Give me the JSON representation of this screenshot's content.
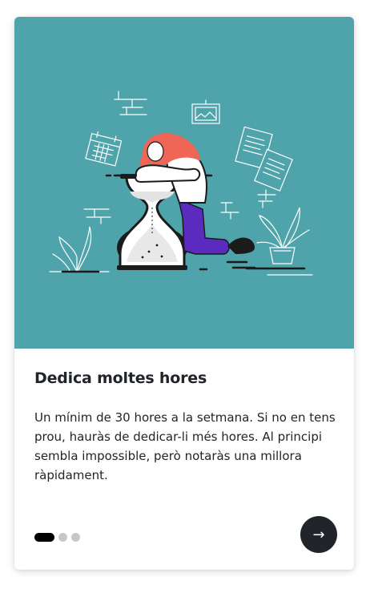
{
  "card": {
    "title": "Dedica moltes hores",
    "text": "Un mínim de 30 hores a la setmana. Si no en tens prou, hauràs de dedicar-li més hores. Al principi sembla impossible, però notaràs una millora ràpidament.",
    "illustration_icon": "hourglass-woman-illustration",
    "hero_color": "#4fa3aa"
  },
  "pagination": {
    "total": 3,
    "current": 1
  },
  "next_button": {
    "label": "→",
    "icon": "arrow-right-icon",
    "color": "#212529"
  }
}
